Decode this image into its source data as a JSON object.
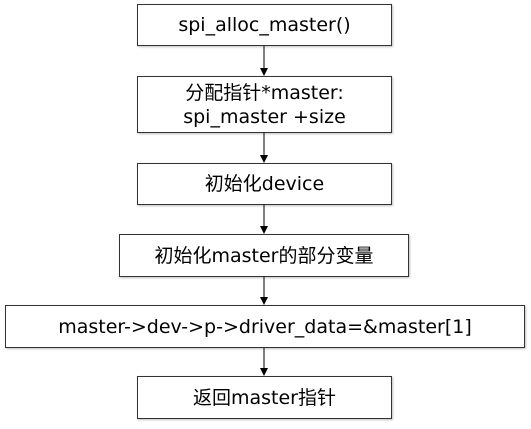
{
  "steps": [
    {
      "lines": [
        "spi_alloc_master()"
      ]
    },
    {
      "lines": [
        "分配指针*master:",
        "spi_master +size"
      ]
    },
    {
      "lines": [
        "初始化device"
      ]
    },
    {
      "lines": [
        "初始化master的部分变量"
      ]
    },
    {
      "lines": [
        "master->dev->p->driver_data=&master[1]"
      ]
    },
    {
      "lines": [
        "返回master指针"
      ]
    }
  ]
}
